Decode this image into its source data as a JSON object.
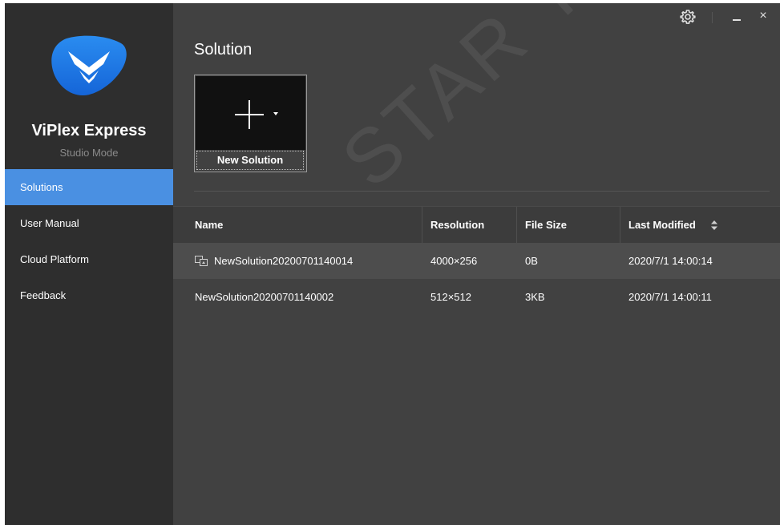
{
  "app": {
    "name": "ViPlex Express",
    "mode": "Studio Mode"
  },
  "sidebar": {
    "items": [
      {
        "label": "Solutions",
        "active": true
      },
      {
        "label": "User Manual",
        "active": false
      },
      {
        "label": "Cloud Platform",
        "active": false
      },
      {
        "label": "Feedback",
        "active": false
      }
    ]
  },
  "window_controls": {
    "icons": [
      "gear-icon",
      "minimize-icon",
      "close-icon"
    ],
    "close_glyph": "×"
  },
  "main": {
    "title": "Solution",
    "new_solution_label": "New Solution",
    "table": {
      "columns": [
        "Name",
        "Resolution",
        "File Size",
        "Last Modified"
      ],
      "sort_column": "Last Modified",
      "rows": [
        {
          "name": "NewSolution20200701140014",
          "resolution": "4000×256",
          "file_size": "0B",
          "last_modified": "2020/7/1 14:00:14",
          "selected": true
        },
        {
          "name": "NewSolution20200701140002",
          "resolution": "512×512",
          "file_size": "3KB",
          "last_modified": "2020/7/1 14:00:11",
          "selected": false
        }
      ]
    }
  },
  "watermark": "STAR TECH CO",
  "colors": {
    "accent": "#4a90e2",
    "sidebar_bg": "#2e2e2e",
    "main_bg": "#414141",
    "logo_blue": "#1e7fe6"
  }
}
